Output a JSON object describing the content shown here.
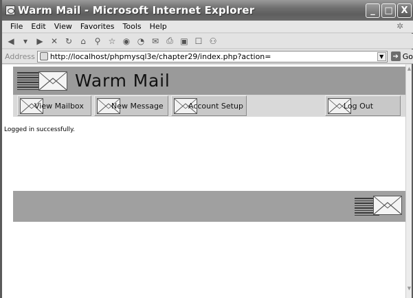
{
  "window": {
    "title": "Warm Mail - Microsoft Internet Explorer",
    "controls": {
      "minimize": "_",
      "maximize": "□",
      "close": "X"
    }
  },
  "menu": [
    "File",
    "Edit",
    "View",
    "Favorites",
    "Tools",
    "Help"
  ],
  "toolbar_icons": [
    "back-icon",
    "forward-icon",
    "stop-icon",
    "refresh-icon",
    "home-icon",
    "search-icon",
    "favorites-icon",
    "media-icon",
    "history-icon",
    "mail-icon",
    "print-icon",
    "edit-icon",
    "discuss-icon",
    "messenger-icon"
  ],
  "address": {
    "label": "Address",
    "url": "http://localhost/phpmysql3e/chapter29/index.php?action=",
    "go_label": "Go"
  },
  "page": {
    "brand": "Warm Mail",
    "nav": [
      {
        "label": "View Mailbox"
      },
      {
        "label": "New Message"
      },
      {
        "label": "Account Setup"
      },
      {
        "label": "Log Out"
      }
    ],
    "status_message": "Logged in successfully."
  },
  "colors": {
    "banner": "#9a9a9a",
    "nav_row": "#d9d9d9",
    "footer": "#a0a0a0",
    "title_bar": "#6e6e6e"
  }
}
